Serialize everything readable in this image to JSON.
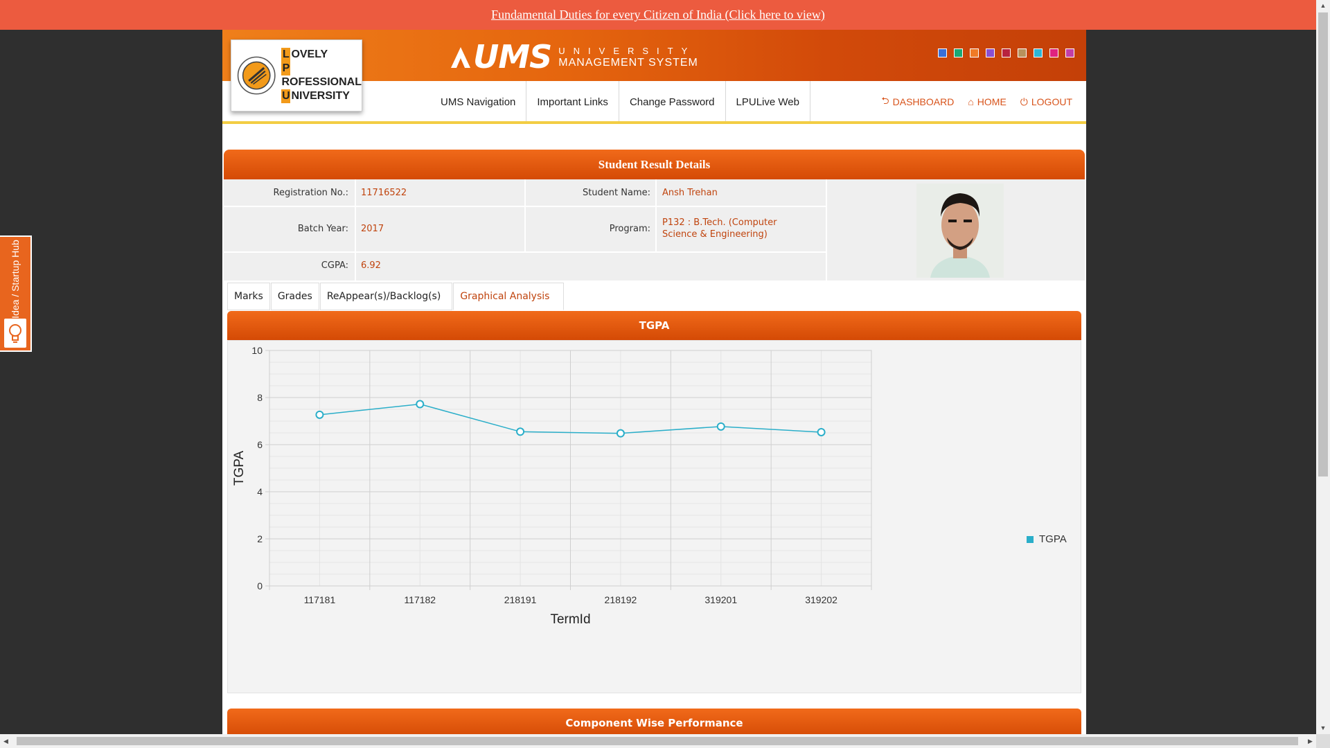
{
  "banner": {
    "text": "Fundamental Duties for every Citizen of India (Click here to view)"
  },
  "side_tab": {
    "label": "Idea / Startup Hub"
  },
  "logo": {
    "line1": "OVELY",
    "line2": "ROFESSIONAL",
    "line3": "NIVERSITY",
    "l1": "L",
    "l2": "P",
    "l3": "U"
  },
  "brand": {
    "name": "UMS",
    "sub1": "UNIVERSITY",
    "sub2": "MANAGEMENT SYSTEM"
  },
  "theme_swatches": [
    "#3a6fd8",
    "#1aa874",
    "#f07a26",
    "#8a4fd1",
    "#b8233f",
    "#b8925c",
    "#2db6d6",
    "#e0227e",
    "#c23fa7"
  ],
  "nav": {
    "items": [
      "UMS Navigation",
      "Important Links",
      "Change Password",
      "LPULive Web"
    ],
    "dashboard": "DASHBOARD",
    "home": "HOME",
    "logout": "LOGOUT"
  },
  "result": {
    "title": "Student Result Details",
    "reg_label": "Registration No.:",
    "reg_value": "11716522",
    "name_label": "Student Name:",
    "name_value": "Ansh Trehan",
    "batch_label": "Batch Year:",
    "batch_value": "2017",
    "program_label": "Program:",
    "program_value_1": "P132 : B.Tech. (Computer",
    "program_value_2": "Science & Engineering)",
    "cgpa_label": "CGPA:",
    "cgpa_value": "6.92"
  },
  "tabs": [
    "Marks",
    "Grades",
    "ReAppear(s)/Backlog(s)",
    "Graphical Analysis"
  ],
  "active_tab": "Graphical Analysis",
  "chart_title": "TGPA",
  "chart_data": {
    "type": "line",
    "categories": [
      "117181",
      "117182",
      "218191",
      "218192",
      "319201",
      "319202"
    ],
    "series": [
      {
        "name": "TGPA",
        "values": [
          7.27,
          7.72,
          6.55,
          6.48,
          6.77,
          6.53
        ],
        "color": "#2aaec9"
      }
    ],
    "xlabel": "TermId",
    "ylabel": "TGPA",
    "ylim": [
      0,
      10
    ],
    "yticks": [
      0,
      2,
      4,
      6,
      8,
      10
    ],
    "grid": true,
    "legend": "right"
  },
  "component_title": "Component Wise Performance"
}
